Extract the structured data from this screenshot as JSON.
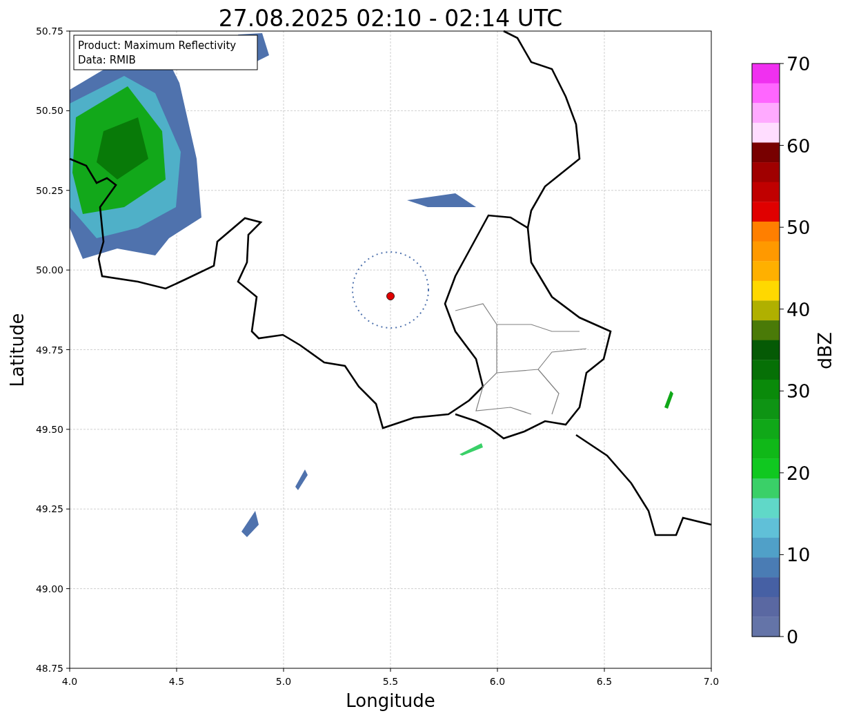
{
  "title": "27.08.2025 02:10 - 02:14 UTC",
  "annotation": [
    "Product: Maximum Reflectivity",
    "Data: RMIB"
  ],
  "xlabel": "Longitude",
  "ylabel": "Latitude",
  "xticks": [
    "4.0",
    "4.5",
    "5.0",
    "5.5",
    "6.0",
    "6.5",
    "7.0"
  ],
  "yticks": [
    "50.75",
    "50.50",
    "50.25",
    "50.00",
    "49.75",
    "49.50",
    "49.25",
    "49.00",
    "48.75"
  ],
  "colorbar": {
    "label": "dBZ",
    "ticks": [
      "70",
      "60",
      "50",
      "40",
      "30",
      "20",
      "10",
      "0"
    ],
    "segments": [
      {
        "color": "#f030f0"
      },
      {
        "color": "#ff66ff"
      },
      {
        "color": "#ffaaff"
      },
      {
        "color": "#ffddff"
      },
      {
        "color": "#780000"
      },
      {
        "color": "#a00000"
      },
      {
        "color": "#c00000"
      },
      {
        "color": "#e00000"
      },
      {
        "color": "#ff7f00"
      },
      {
        "color": "#ff9900"
      },
      {
        "color": "#ffb000"
      },
      {
        "color": "#ffd800"
      },
      {
        "color": "#b0b000"
      },
      {
        "color": "#4a7a08"
      },
      {
        "color": "#055a05"
      },
      {
        "color": "#067006"
      },
      {
        "color": "#0a8a0a"
      },
      {
        "color": "#0e9414"
      },
      {
        "color": "#10a818"
      },
      {
        "color": "#10b818"
      },
      {
        "color": "#10c820"
      },
      {
        "color": "#3ad068"
      },
      {
        "color": "#60d8c8"
      },
      {
        "color": "#60c0d8"
      },
      {
        "color": "#50a0c8"
      },
      {
        "color": "#4a7cb4"
      },
      {
        "color": "#4660a4"
      },
      {
        "color": "#5a68a2"
      },
      {
        "color": "#6474a8"
      }
    ]
  }
}
